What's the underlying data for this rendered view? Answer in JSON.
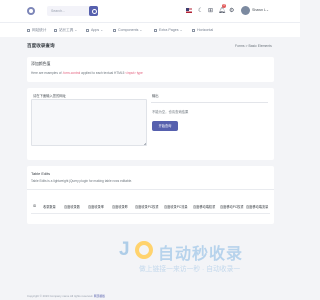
{
  "header": {
    "search_placeholder": "Search...",
    "user_name": "Shawn L",
    "notification_count": "3",
    "icons": [
      "logo-icon",
      "search-icon",
      "us-flag-icon",
      "moon-icon",
      "grid-icon",
      "bell-icon",
      "gear-icon",
      "avatar"
    ]
  },
  "nav": {
    "items": [
      {
        "label": "网站统计",
        "icon": "dashboard-icon"
      },
      {
        "label": "站长工具 ⌄",
        "icon": "tools-icon"
      },
      {
        "label": "Apps ⌄",
        "icon": "apps-icon"
      },
      {
        "label": "Components ⌄",
        "icon": "components-icon"
      },
      {
        "label": "Extra Pages ⌄",
        "icon": "pages-icon"
      },
      {
        "label": "Horizontal",
        "icon": "layout-icon"
      }
    ]
  },
  "page": {
    "title": "百度收录查询",
    "breadcrumb": "Forms  >  Basic Elements"
  },
  "card1": {
    "title": "添加颜色值",
    "text_prefix": "Here are examples of",
    "link1": ".form-control",
    "text_mid": "applied to each textual HTML5",
    "link2": "<input> type"
  },
  "card2": {
    "textarea_label": "请在下面输入您的网址",
    "result_label": "输出",
    "result_text": "不能为空，也请查询结果",
    "button": "开始查询"
  },
  "card3": {
    "title": "Table Edits",
    "subtitle": "Table Edits is a lightweight jQuery plugin for making table rows editable.",
    "columns": [
      "ID",
      "收录数量",
      "百度收录数",
      "百度收录率",
      "百度收录昨",
      "百度收录PC权重",
      "百度收录PC流量",
      "百度移动端权重",
      "百度移动PC权重",
      "百度移动端流量"
    ]
  },
  "watermark": {
    "big": "自动秒收录",
    "sub": "做上链接一来访一秒 · 自动收录一"
  },
  "footer": {
    "text": "Copyright © 2023 Company name All rights reserved.",
    "link": "网页模板"
  },
  "colors": {
    "primary": "#5660ae",
    "link_pink": "#e25c7a",
    "badge": "#e25c5c",
    "background": "#f3f4f7"
  }
}
